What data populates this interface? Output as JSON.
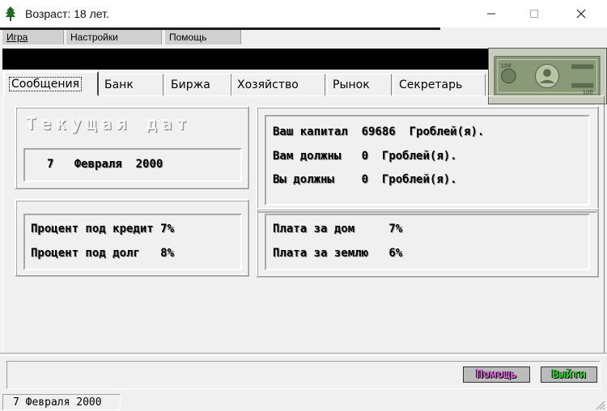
{
  "window": {
    "title": "Возраст: 18 лет."
  },
  "menu": {
    "game": "Игра",
    "settings": "Настройки",
    "help": "Помощь"
  },
  "tabs": [
    "Сообщения",
    "Банк",
    "Биржа",
    "Хозяйство",
    "Рынок",
    "Секретарь"
  ],
  "active_tab": "Сообщения",
  "date_panel": {
    "heading": "Текущая дат",
    "day": "7",
    "month": "Февраля",
    "year": "2000"
  },
  "rates": {
    "credit_label": "Процент под кредит",
    "credit_value": "7%",
    "debt_label": "Процент под долг",
    "debt_value": "8%"
  },
  "capital": {
    "capital_label": "Ваш капитал",
    "capital_value": "69686",
    "capital_unit": "Гроблей(я).",
    "owed_to_you_label": "Вам должны",
    "owed_to_you_value": "0",
    "owed_to_you_unit": "Гроблей(я).",
    "you_owe_label": "Вы должны",
    "you_owe_value": "0",
    "you_owe_unit": "Гроблей(я)."
  },
  "fees": {
    "house_label": "Плата за дом",
    "house_value": "7%",
    "land_label": "Плата за землю",
    "land_value": "6%"
  },
  "buttons": {
    "help": "Помощь",
    "exit": "Выйти"
  },
  "statusbar": {
    "date": "7 Февраля 2000"
  },
  "colors": {
    "help_button_text": "#e070e0",
    "exit_button_text": "#3ad43a",
    "banknote": "#8a9a78"
  }
}
